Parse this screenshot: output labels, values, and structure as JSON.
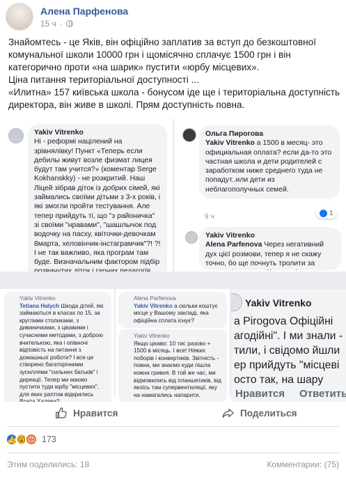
{
  "post": {
    "author": "Алена Парфенова",
    "time": "15 ч",
    "text_lines": [
      "Знайомтесь - це Яків, він офіційно заплатив за вступ до безкоштовної комунальної школи 10000 грн і щомісячно сплачує 1500 грн і він категорично проти «на шарик» пустити «юрбу місцевих».",
      "Ціна питання територіальної доступності ...",
      "«Илитна» 157 київська школа - бонусом іде ще і територіальна доступність директора, він живе в школі. Прям доступність повна."
    ]
  },
  "screenshots": {
    "shot1": {
      "author": "Yakiv Vitrenko",
      "text": "Ні - реформі націлений на зрівнялівку! Пункт «Теперь если дебилы живут возле физмат лицея будут там учится?» (коментар Serge Kokhanskky) - не розкритий. Наш Ліцей зібрав діток із добрих сімей, які займались своїми дітьми з 3-х років, і які змогли пройти тестування. Але тепер прийдуть ті, що \"з районичка\" зі своїми \"нравами\", \"шашлычок под водочку на пасху, квiточки-девочкам 8марта, хеловiнчик-iнстаграмчик\"?! ?! І не так важливо, яка програм там буде. Визначальним фактором підбір розвинутих діток і гарних педагогів."
    },
    "shot2": {
      "comment1_author": "Ольга Пирогова",
      "comment1_mention": "Yakiv Vitrenko",
      "comment1_text": "а 1500 в месяц- это официальная оплата? если да-то это частная школа и дети родителей с заработком ниже среднего туда не попадут..или дети из неблагополучных семей.",
      "comment1_time": "9 ч",
      "comment1_likes": "1",
      "comment2_author": "Yakiv Vitrenko",
      "comment2_mention": "Alena Parfenova",
      "comment2_text": "Через негативний дух цієї розмови, тепер я не скажу точно, бо ще почнуть тролити за членські внески... Це один із чисел"
    },
    "shot3": {
      "author": "Yakiv Vitrenko",
      "mention": "Tetiana Halych",
      "text": "Шкода дітей, які займаються в класах по 15, за круглими столиками, з диваничками, з цікавими і сучасними методами, з доброю вчителькою, яка і опівночі відповість на питання з домашньої роботи? І все це створено багаторічними зусиллями \"сильних батьків\" і дирекції. Тепер ми маємо пустити туди юрбу \"місцевих\", для яких раптом відкрились Врата Халяви?"
    },
    "shot4": {
      "c1_author": "Alena Parfenova",
      "c1_mention": "Yakiv Vitrenko",
      "c1_text": "а скільки коштує місце у Вашому закладі, яка офіційна сплата існує?",
      "c2_author": "Yakiv Vitrenko",
      "c2_text": "Якщо цікаво: 10 тис разово + 1500 в місяць. І все! Ніяких поборів і конвертиків. Звітність - повна, ми знаємо куди пішла кожна гривня. В той же час, ми відмовились від планшетиків, від якоїсь там супервентиляції, яку на намагались напарити."
    },
    "shot5": {
      "author": "Yakiv Vitrenko",
      "lines": [
        "a Pirogova Офіційні",
        "агодійні\". І ми знали -",
        "тили, і свідомо йшли",
        "ер прийдуть \"місцеві",
        "осто так, на шару"
      ],
      "action_like": "Нравится",
      "action_reply": "Ответить"
    }
  },
  "actions": {
    "like": "Нравится",
    "share": "Поделиться"
  },
  "reactions": {
    "count": "173"
  },
  "footer": {
    "shares": "Этим поделились: 18",
    "comments": "Комментарии: (75)"
  }
}
